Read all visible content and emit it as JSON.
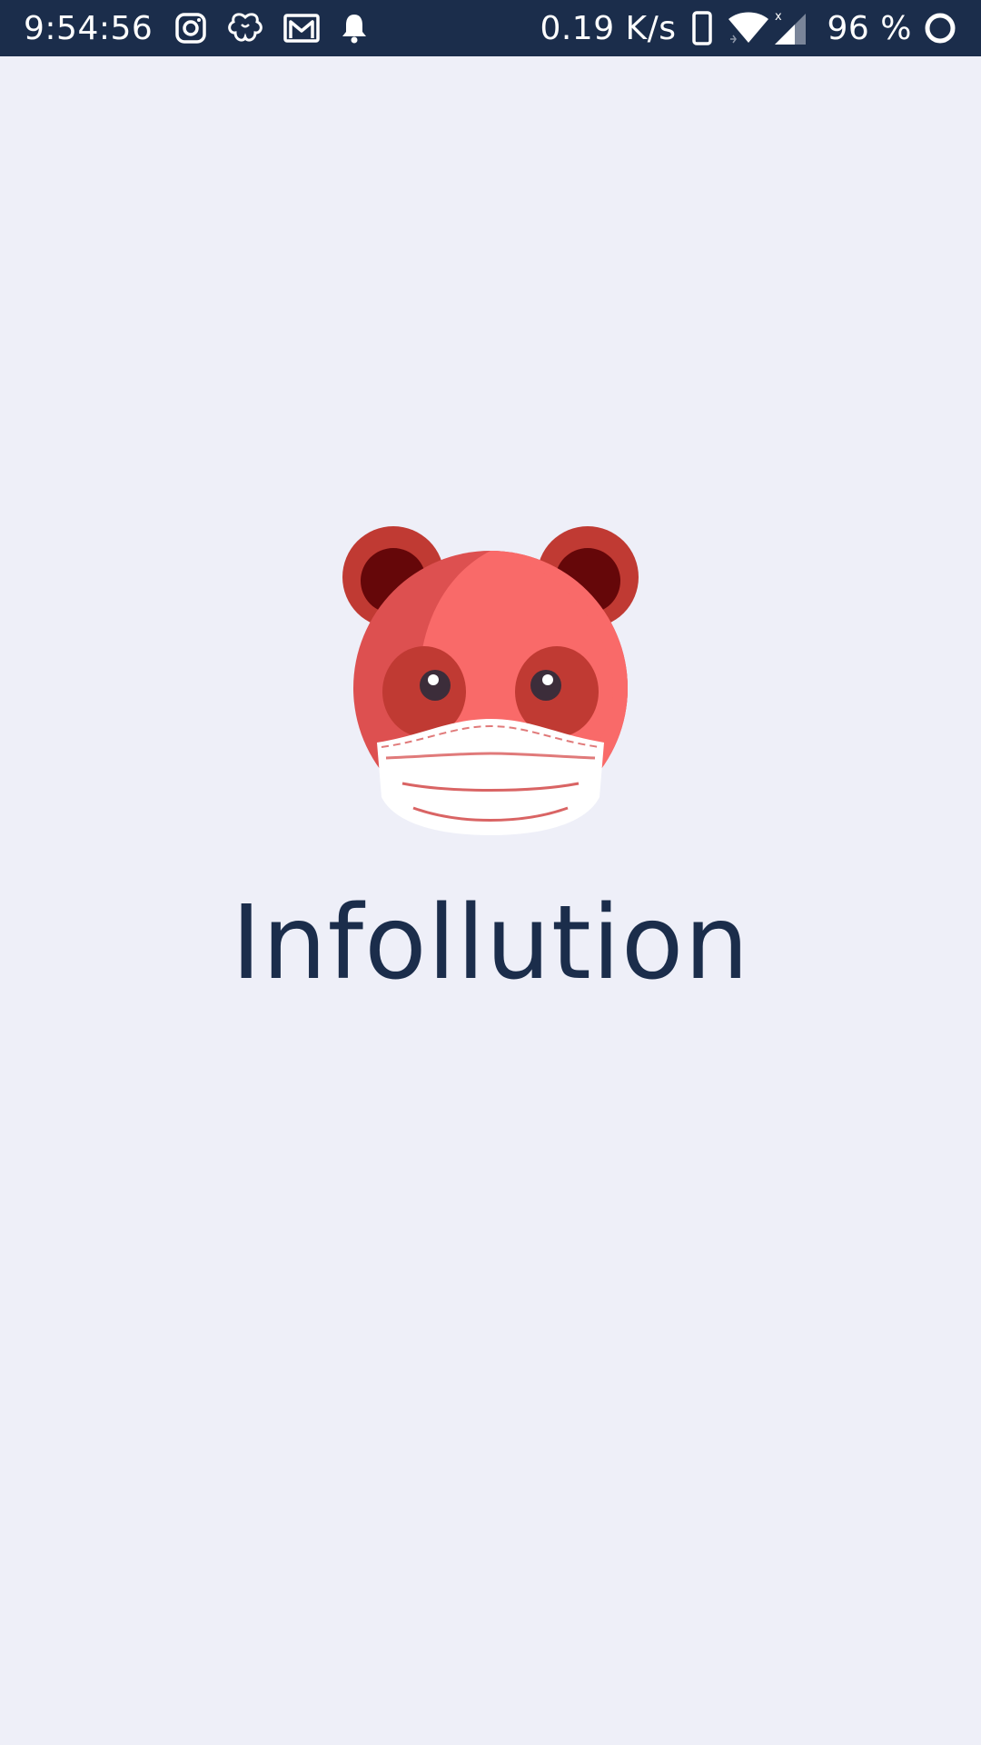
{
  "status_bar": {
    "time": "9:54:56",
    "network_speed": "0.19 K/s",
    "battery": "96 %",
    "notification_icons": [
      "instagram-icon",
      "clover-icon",
      "gmail-icon",
      "bell-icon"
    ],
    "system_icons": [
      "phone-icon",
      "wifi-icon",
      "signal-icon",
      "battery-ring-icon"
    ],
    "background_color": "#1b2d4b"
  },
  "splash": {
    "app_name": "Infollution",
    "logo_icon": "panda-mask-logo-icon",
    "background_color": "#eeeff8",
    "title_color": "#1b2d4b"
  }
}
